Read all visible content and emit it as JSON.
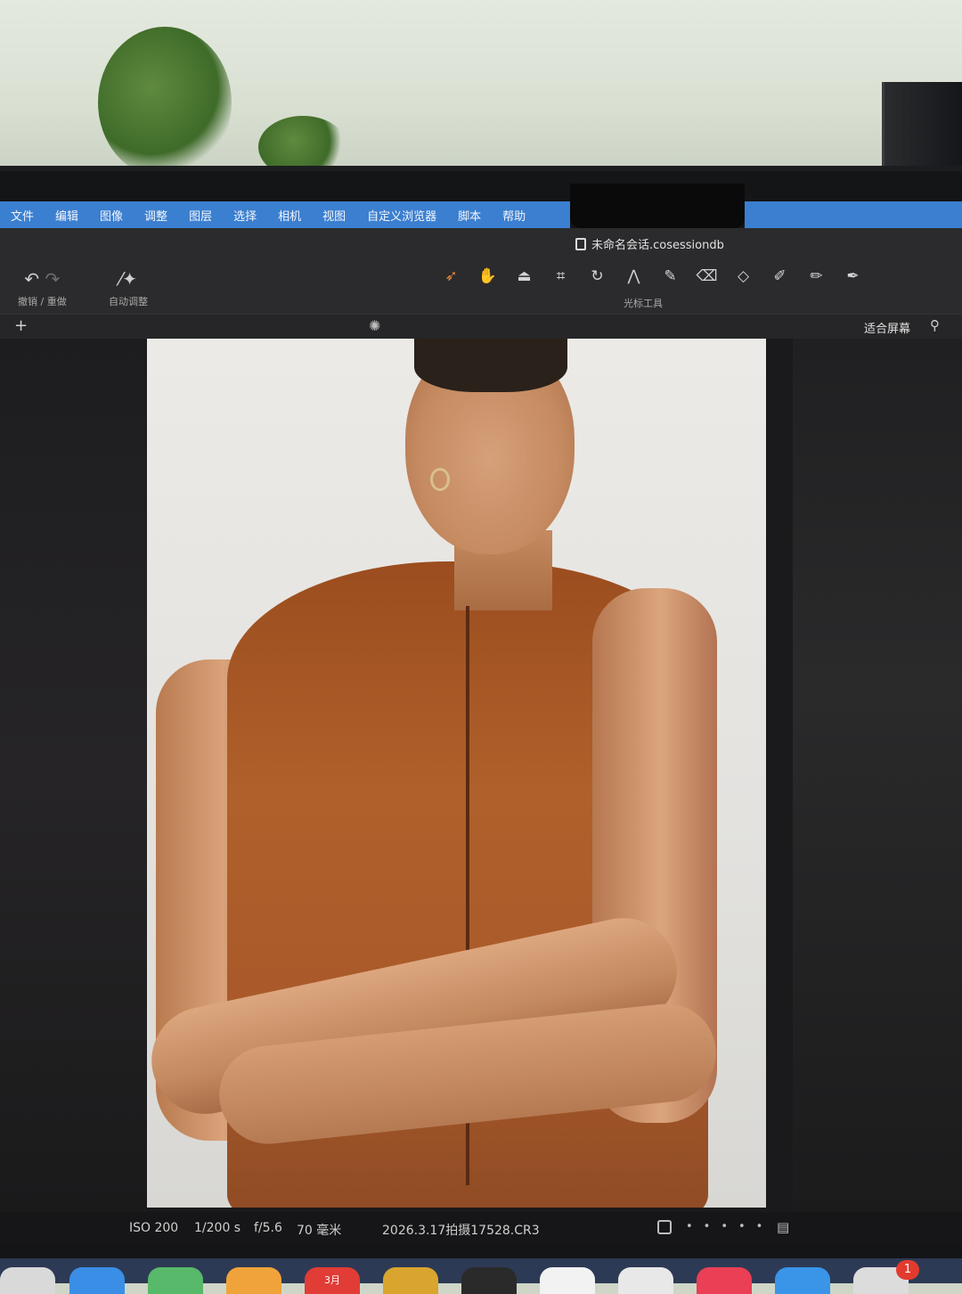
{
  "menubar": {
    "items": [
      "文件",
      "编辑",
      "图像",
      "调整",
      "图层",
      "选择",
      "相机",
      "视图",
      "自定义浏览器",
      "脚本",
      "帮助"
    ]
  },
  "document": {
    "title": "未命名会话.cosessiondb"
  },
  "toolbar": {
    "undo_redo_label": "撤销 / 重做",
    "auto_adjust_label": "自动调整",
    "cursor_tools_label": "光标工具",
    "cursor_tools": [
      "pointer-tool-icon",
      "hand-tool-icon",
      "bucket-tool-icon",
      "crop-tool-icon",
      "rotate-tool-icon",
      "keystone-tool-icon",
      "brush-tool-icon",
      "eraser-tool-icon",
      "erase-mask-icon",
      "picker-tool-icon",
      "annotate-tool-icon",
      "pen-tool-icon"
    ],
    "active_tool": "pointer-tool-icon"
  },
  "viewer_bar": {
    "fit_label": "适合屏幕"
  },
  "status": {
    "iso": "ISO 200",
    "shutter": "1/200 s",
    "aperture": "f/5.6",
    "focal": "70 毫米",
    "filename": "2026.3.17拍摄17528.CR3"
  },
  "dock": {
    "calendar_label": "3月",
    "badge": "1"
  },
  "colors": {
    "menubar": "#3b7fd0",
    "active_tool": "#e58a3a",
    "toolbar_bg": "#2b2b2d"
  }
}
